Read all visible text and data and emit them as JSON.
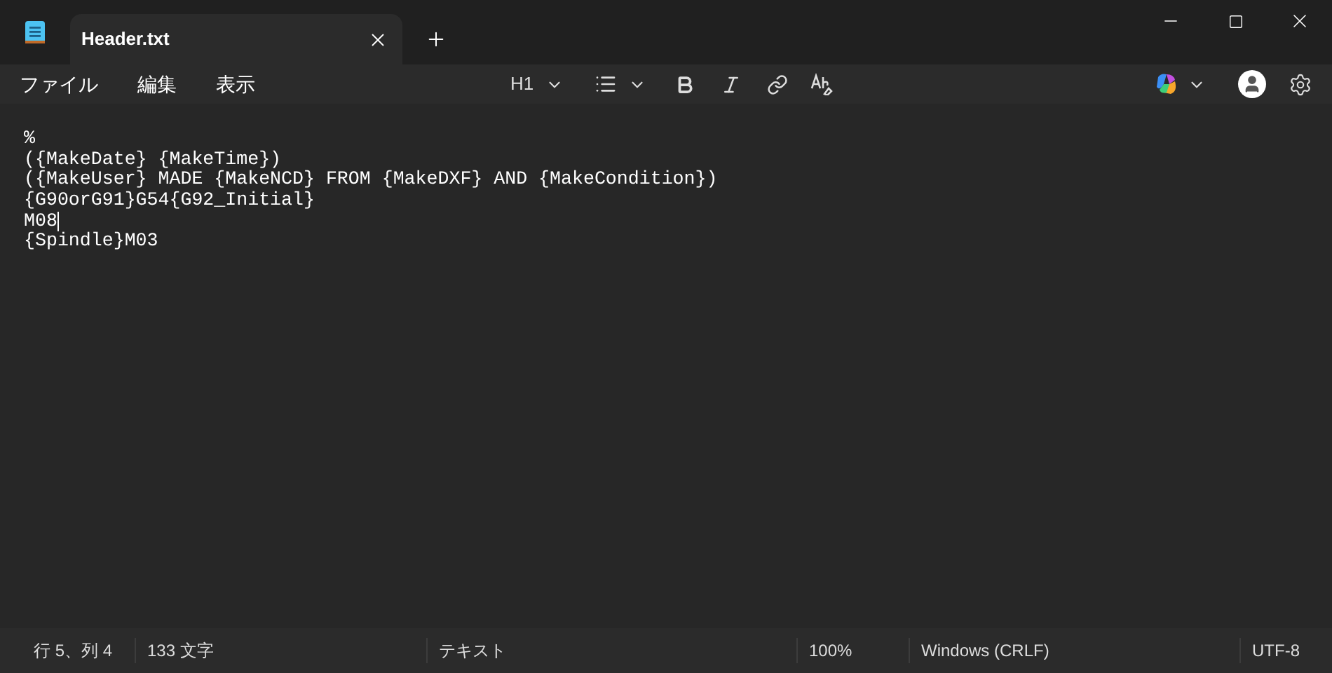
{
  "tabs": [
    {
      "label": "Header.txt",
      "selected": true
    }
  ],
  "menu": [
    "ファイル",
    "編集",
    "表示"
  ],
  "toolbar": {
    "heading": "H1"
  },
  "editor": {
    "lines": [
      {
        "text": "%",
        "caret": false
      },
      {
        "text": "({MakeDate} {MakeTime})",
        "caret": false
      },
      {
        "text": "({MakeUser} MADE {MakeNCD} FROM {MakeDXF} AND {MakeCondition})",
        "caret": false
      },
      {
        "text": "{G90orG91}G54{G92_Initial}",
        "caret": false
      },
      {
        "text": "M08",
        "caret": true
      },
      {
        "text": "{Spindle}M03",
        "caret": false
      }
    ]
  },
  "status_bar": [
    {
      "text": "行 5、列 4",
      "kind": "narrow"
    },
    {
      "text": "133 文字",
      "kind": "wide"
    },
    {
      "text": "テキスト",
      "kind": "widest"
    },
    {
      "text": "100%",
      "kind": "narrow"
    },
    {
      "text": "Windows (CRLF)",
      "kind": "medium"
    },
    {
      "text": "UTF-8",
      "kind": "last"
    }
  ]
}
